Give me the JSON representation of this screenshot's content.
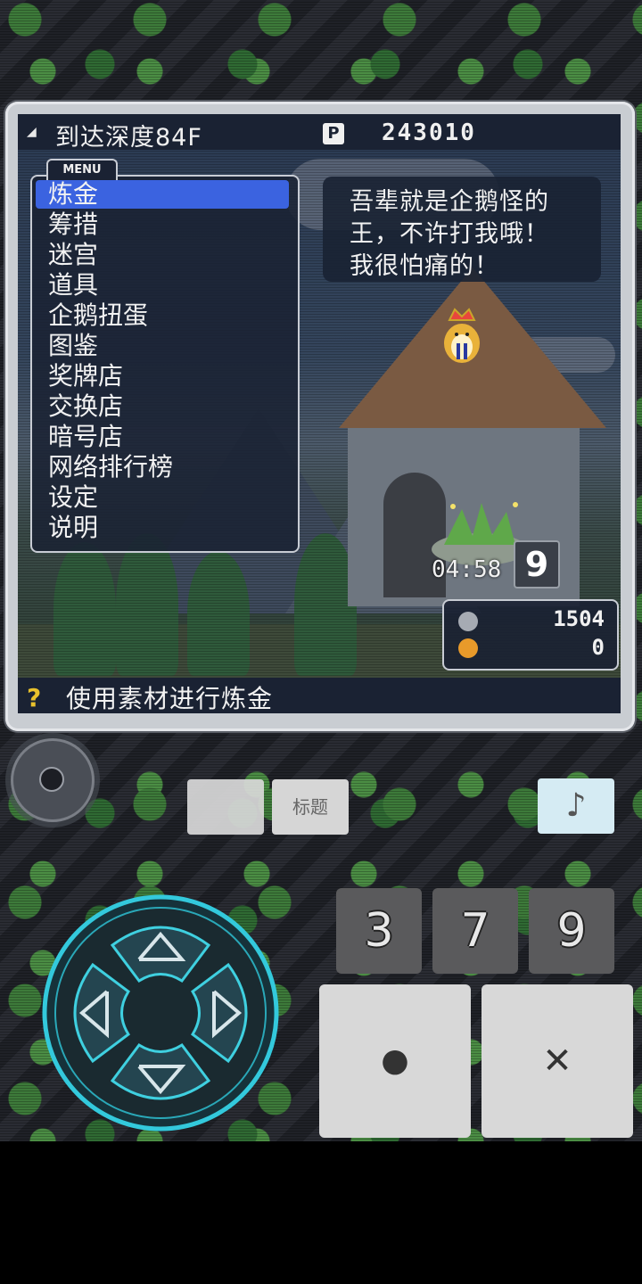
{
  "header": {
    "depth_label": "到达深度84F",
    "points_icon": "P",
    "points_value": "243010"
  },
  "menu": {
    "tab_label": "MENU",
    "items": [
      {
        "label": "炼金",
        "selected": true
      },
      {
        "label": "筹措"
      },
      {
        "label": "迷宫"
      },
      {
        "label": "道具"
      },
      {
        "label": "企鹅扭蛋"
      },
      {
        "label": "图鉴"
      },
      {
        "label": "奖牌店"
      },
      {
        "label": "交换店"
      },
      {
        "label": "暗号店"
      },
      {
        "label": "网络排行榜"
      },
      {
        "label": "设定"
      },
      {
        "label": "说明"
      }
    ]
  },
  "dialogue": {
    "lines": [
      "吾辈就是企鹅怪的",
      "王，不许打我哦！",
      "我很怕痛的！"
    ]
  },
  "harvest": {
    "timer": "04:58",
    "count": "9"
  },
  "resources": {
    "gem_value": "1504",
    "coin_value": "0"
  },
  "status": {
    "help_icon": "?",
    "text": "使用素材进行炼金"
  },
  "controls": {
    "title_button": "标题",
    "music_icon": "♪",
    "num_buttons": [
      "3",
      "7",
      "9"
    ],
    "circle_button": "●",
    "cross_button": "✕"
  },
  "colors": {
    "menu_highlight": "#3b63e0",
    "panel_bg": "#1a2233",
    "music_button_bg": "#d5ebf3"
  }
}
